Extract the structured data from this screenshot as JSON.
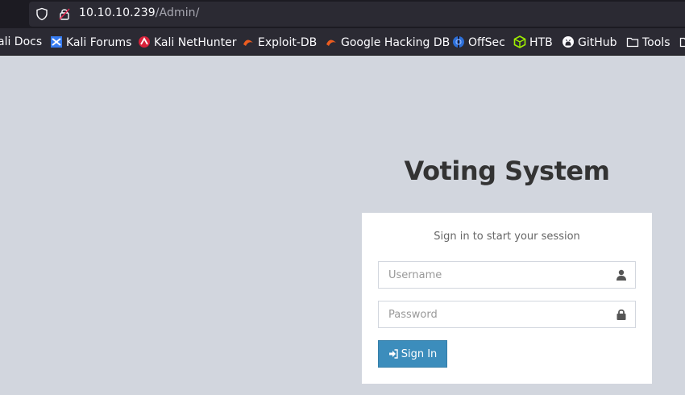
{
  "browser": {
    "url_host": "10.10.10.239",
    "url_path": "/Admin/",
    "bookmarks": [
      {
        "label": "ali Docs",
        "icon": "kali-docs-icon"
      },
      {
        "label": "Kali Forums",
        "icon": "kali-forums-icon"
      },
      {
        "label": "Kali NetHunter",
        "icon": "nethunter-icon"
      },
      {
        "label": "Exploit-DB",
        "icon": "exploit-db-icon"
      },
      {
        "label": "Google Hacking DB",
        "icon": "ghdb-icon"
      },
      {
        "label": "OffSec",
        "icon": "offsec-icon"
      },
      {
        "label": "HTB",
        "icon": "htb-icon"
      },
      {
        "label": "GitHub",
        "icon": "github-icon"
      },
      {
        "label": "Tools",
        "icon": "folder-icon"
      }
    ]
  },
  "page": {
    "title": "Voting System",
    "login_message": "Sign in to start your session",
    "username_placeholder": "Username",
    "password_placeholder": "Password",
    "signin_label": "Sign In"
  },
  "colors": {
    "page_background": "#d2d6de",
    "primary_button": "#3c8dbc",
    "toolbar": "#2b2a33"
  }
}
